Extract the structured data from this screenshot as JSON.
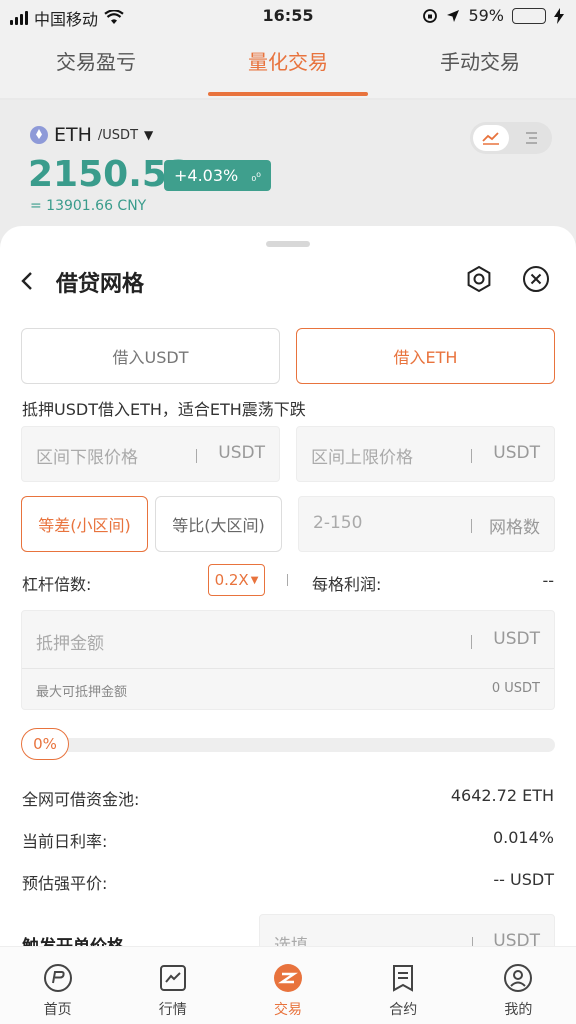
{
  "status_bar": {
    "carrier": "中国移动",
    "time": "16:55",
    "battery": "59%"
  },
  "tabs": [
    {
      "label": "交易盈亏",
      "active": false
    },
    {
      "label": "量化交易",
      "active": true
    },
    {
      "label": "手动交易",
      "active": false
    }
  ],
  "market": {
    "base": "ETH",
    "quote": "/USDT",
    "price": "2150.53",
    "change": "+4.03%",
    "cny": "= 13901.66 CNY"
  },
  "sheet": {
    "title": "借贷网格",
    "borrow_usdt": "借入USDT",
    "borrow_eth": "借入ETH",
    "description": "抵押USDT借入ETH，适合ETH震荡下跌",
    "lower_price_placeholder": "区间下限价格",
    "upper_price_placeholder": "区间上限价格",
    "usdt_unit": "USDT",
    "mode_arithmetic": "等差(小区间)",
    "mode_geometric": "等比(大区间)",
    "grid_count_placeholder": "2-150",
    "grid_count_unit": "网格数",
    "leverage_label": "杠杆倍数:",
    "leverage_value": "0.2X",
    "profit_label": "每格利润:",
    "profit_value": "--",
    "collateral_placeholder": "抵押金额",
    "max_collateral_label": "最大可抵押金额",
    "max_collateral_value": "0 USDT",
    "progress_label": "0%",
    "progress_value": 0,
    "pool_label": "全网可借资金池:",
    "pool_value": "4642.72 ETH",
    "rate_label": "当前日利率:",
    "rate_value": "0.014%",
    "liq_label": "预估强平价:",
    "liq_value": "-- USDT",
    "trigger_label": "触发开单价格",
    "trigger_placeholder": "选填"
  },
  "nav": [
    {
      "label": "首页",
      "icon": "home-icon",
      "active": false
    },
    {
      "label": "行情",
      "icon": "market-chart-icon",
      "active": false
    },
    {
      "label": "交易",
      "icon": "trade-icon",
      "active": true
    },
    {
      "label": "合约",
      "icon": "contract-icon",
      "active": false
    },
    {
      "label": "我的",
      "icon": "profile-icon",
      "active": false
    }
  ],
  "colors": {
    "accent": "#e8733d",
    "up": "#3f9f8d"
  }
}
